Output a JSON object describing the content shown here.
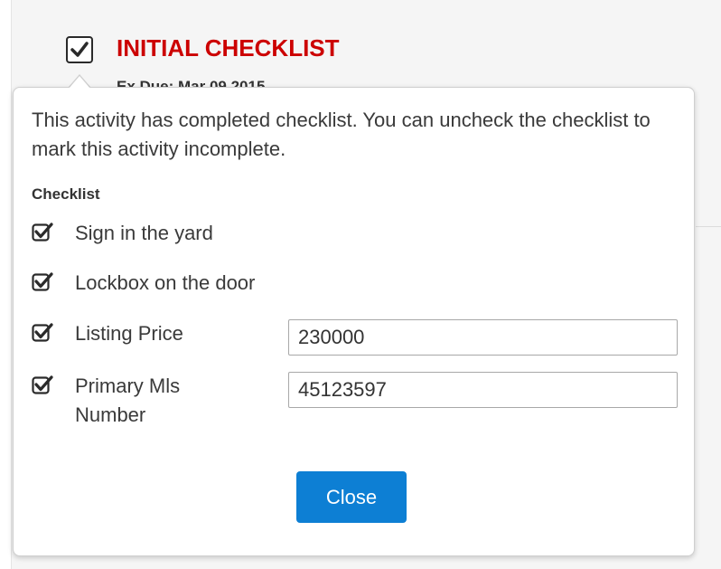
{
  "activity": {
    "title": "INITIAL CHECKLIST",
    "due_partial": "Ex Due: Mar 09 2015",
    "checked": true,
    "title_color": "#cc0000"
  },
  "popover": {
    "message": "This activity has completed checklist. You can uncheck the checklist to mark this activity incomplete.",
    "checklist_heading": "Checklist",
    "items": [
      {
        "label": "Sign in the yard",
        "checked": true
      },
      {
        "label": "Lockbox on the door",
        "checked": true
      },
      {
        "label": "Listing Price",
        "checked": true,
        "value": "230000"
      },
      {
        "label": "Primary Mls Number",
        "checked": true,
        "value": "45123597"
      }
    ],
    "close_label": "Close",
    "close_color": "#0d7fd4"
  }
}
